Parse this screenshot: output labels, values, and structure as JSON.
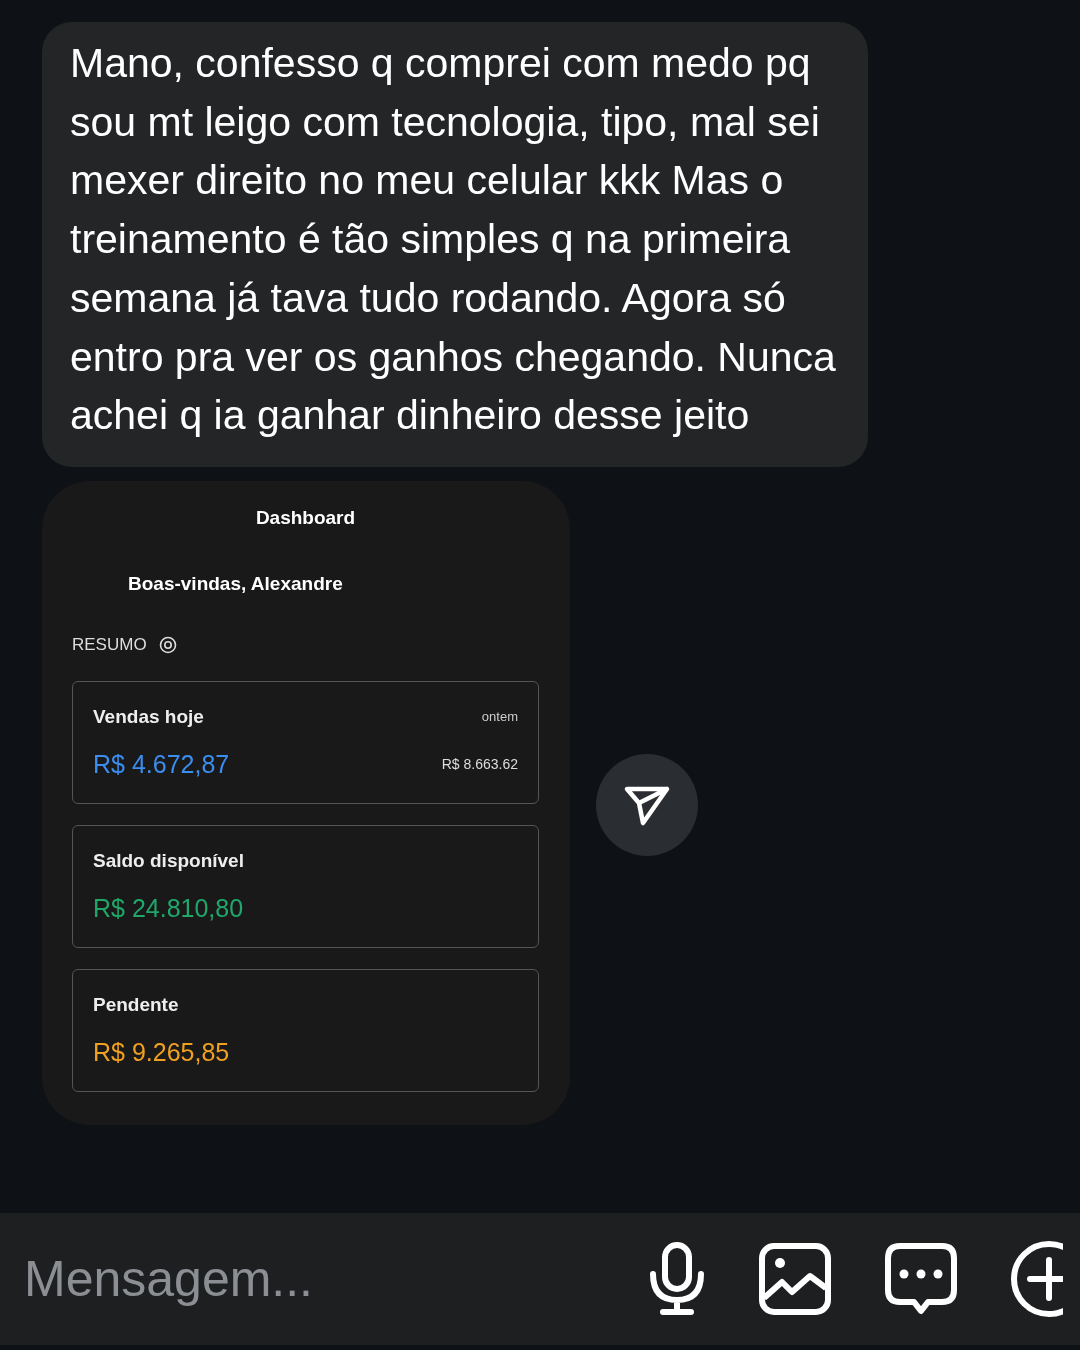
{
  "message": {
    "text": "Mano, confesso q comprei com medo pq sou mt leigo com tecnologia, tipo, mal sei mexer direito no meu celular kkk Mas o treinamento é tão simples q na primeira semana já tava tudo rodando. Agora só entro pra ver os ganhos chegando. Nunca achei q ia ganhar dinheiro desse jeito"
  },
  "dashboard": {
    "title": "Dashboard",
    "greeting": "Boas-vindas, Alexandre",
    "section": "RESUMO",
    "cards": [
      {
        "label": "Vendas hoje",
        "value": "R$ 4.672,87",
        "color": "#3b8ef0",
        "compare_label": "ontem",
        "compare_value": "R$ 8.663.62"
      },
      {
        "label": "Saldo disponível",
        "value": "R$ 24.810,80",
        "color": "#1fa86a"
      },
      {
        "label": "Pendente",
        "value": "R$ 9.265,85",
        "color": "#f0a020"
      }
    ]
  },
  "composer": {
    "placeholder": "Mensagem..."
  }
}
